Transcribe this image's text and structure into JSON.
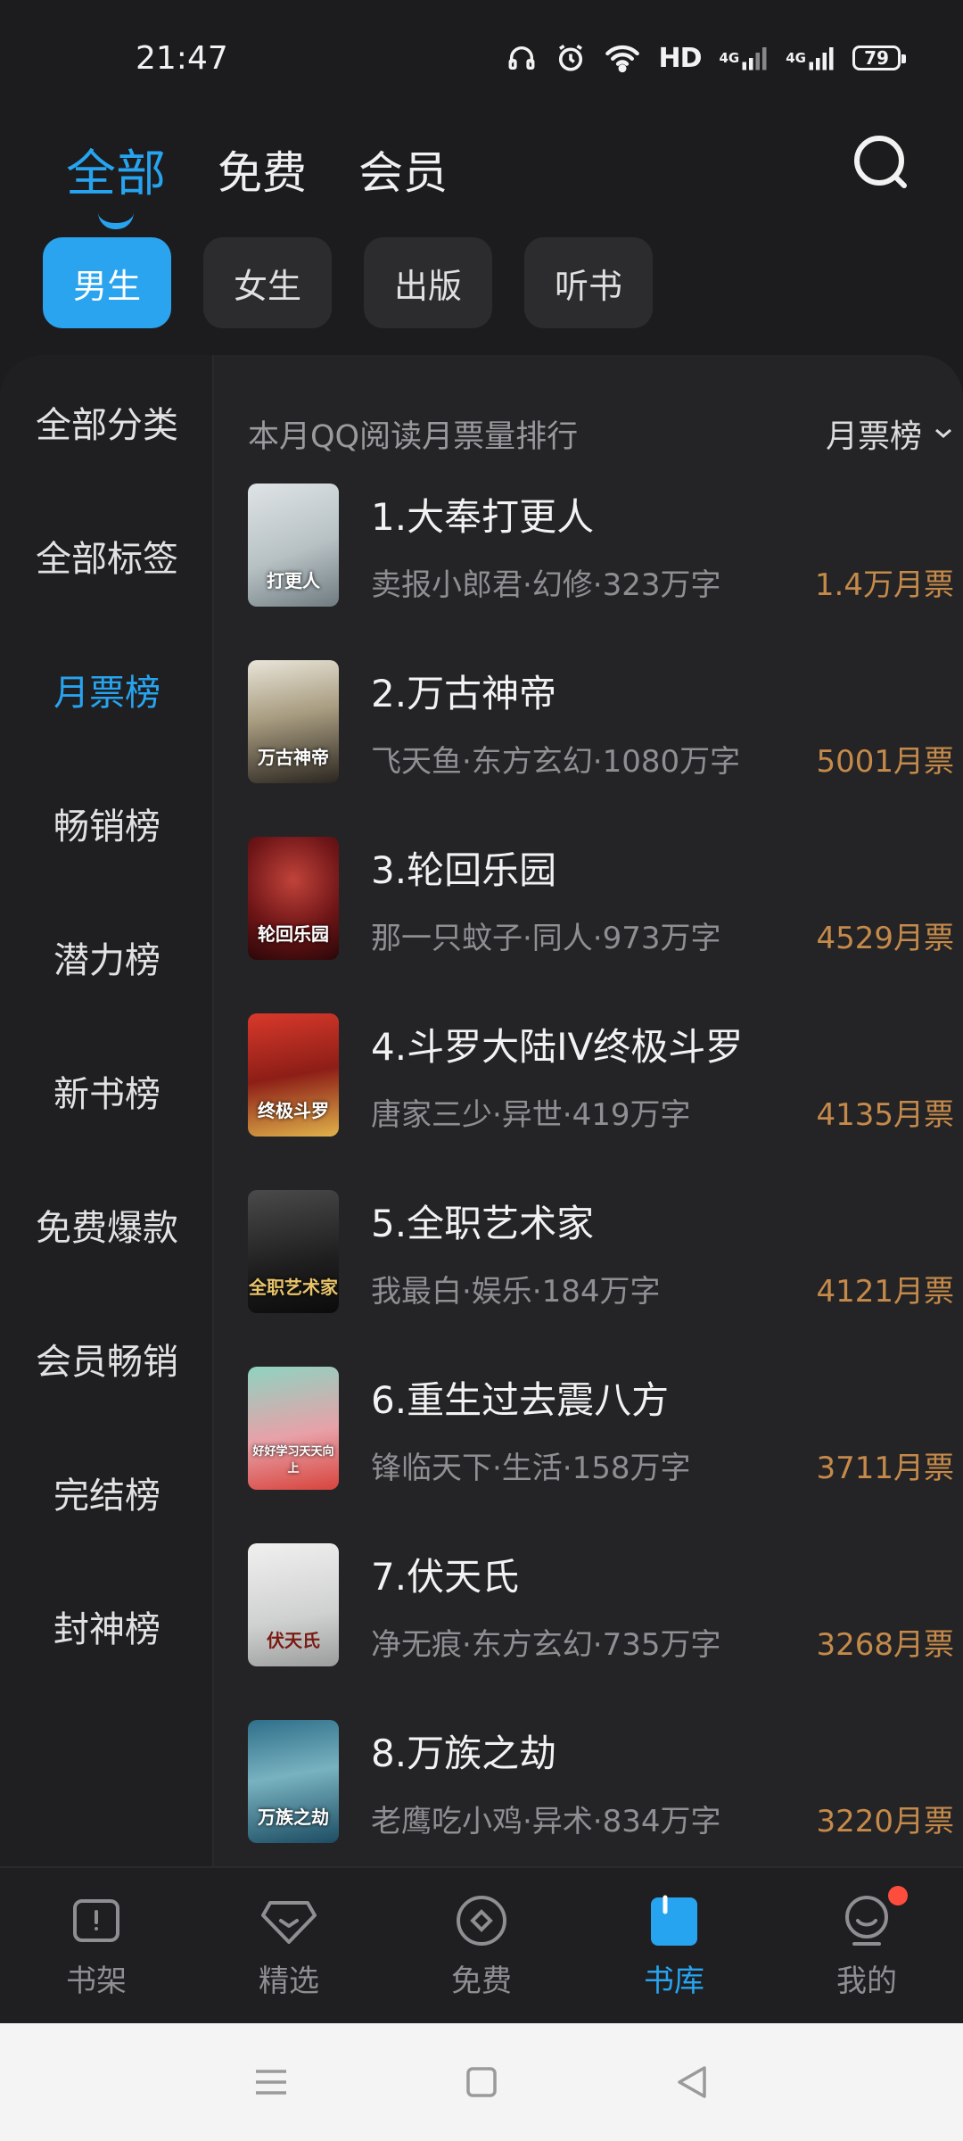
{
  "status": {
    "time": "21:47",
    "network": "HD",
    "signal1": "4G",
    "signal2": "4G",
    "battery": "79",
    "icons": [
      "headphones-icon",
      "alarm-icon",
      "wifi-icon",
      "signal-icon",
      "battery-icon"
    ]
  },
  "top_tabs": [
    {
      "label": "全部",
      "active": true
    },
    {
      "label": "免费",
      "active": false
    },
    {
      "label": "会员",
      "active": false
    }
  ],
  "chips": [
    {
      "label": "男生",
      "active": true
    },
    {
      "label": "女生",
      "active": false
    },
    {
      "label": "出版",
      "active": false
    },
    {
      "label": "听书",
      "active": false
    }
  ],
  "sidebar": {
    "items": [
      {
        "label": "全部分类"
      },
      {
        "label": "全部标签"
      },
      {
        "label": "月票榜",
        "active": true
      },
      {
        "label": "畅销榜"
      },
      {
        "label": "潜力榜"
      },
      {
        "label": "新书榜"
      },
      {
        "label": "免费爆款"
      },
      {
        "label": "会员畅销"
      },
      {
        "label": "完结榜"
      },
      {
        "label": "封神榜"
      }
    ]
  },
  "ranking": {
    "title": "本月QQ阅读月票量排行",
    "sort_label": "月票榜",
    "books": [
      {
        "title": "1.大奉打更人",
        "meta": "卖报小郎君·幻修·323万字",
        "votes": "1.4万月票",
        "cover_text": "打更人"
      },
      {
        "title": "2.万古神帝",
        "meta": "飞天鱼·东方玄幻·1080万字",
        "votes": "5001月票",
        "cover_text": "万古神帝"
      },
      {
        "title": "3.轮回乐园",
        "meta": "那一只蚊子·同人·973万字",
        "votes": "4529月票",
        "cover_text": "轮回乐园"
      },
      {
        "title": "4.斗罗大陆IV终极斗罗",
        "meta": "唐家三少·异世·419万字",
        "votes": "4135月票",
        "cover_text": "终极斗罗"
      },
      {
        "title": "5.全职艺术家",
        "meta": "我最白·娱乐·184万字",
        "votes": "4121月票",
        "cover_text": "全职艺术家"
      },
      {
        "title": "6.重生过去震八方",
        "meta": "锋临天下·生活·158万字",
        "votes": "3711月票",
        "cover_text": "好好学习天天向上"
      },
      {
        "title": "7.伏天氏",
        "meta": "净无痕·东方玄幻·735万字",
        "votes": "3268月票",
        "cover_text": "伏天氏"
      },
      {
        "title": "8.万族之劫",
        "meta": "老鹰吃小鸡·异术·834万字",
        "votes": "3220月票",
        "cover_text": "万族之劫"
      }
    ]
  },
  "bottom_nav": [
    {
      "label": "书架",
      "icon": "bookshelf-icon"
    },
    {
      "label": "精选",
      "icon": "diamond-icon"
    },
    {
      "label": "免费",
      "icon": "free-icon"
    },
    {
      "label": "书库",
      "icon": "library-icon",
      "active": true
    },
    {
      "label": "我的",
      "icon": "profile-icon",
      "badge": true
    }
  ],
  "colors": {
    "accent": "#27a4f0",
    "votes": "#c58a4a",
    "background": "#1c1c1e",
    "panel": "#242426"
  }
}
